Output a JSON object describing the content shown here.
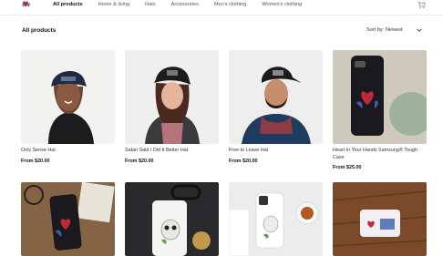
{
  "header": {
    "logo_icon": "heart-butterfly-logo",
    "cart_icon": "shopping-cart-icon",
    "nav": [
      {
        "label": "All products",
        "active": true
      },
      {
        "label": "Home & living",
        "active": false
      },
      {
        "label": "Hats",
        "active": false
      },
      {
        "label": "Accessories",
        "active": false
      },
      {
        "label": "Men's clothing",
        "active": false
      },
      {
        "label": "Women's clothing",
        "active": false
      }
    ]
  },
  "section": {
    "title": "All products",
    "sort_label": "Sort by: Newest",
    "sort_icon": "chevron-down-icon"
  },
  "products": [
    {
      "name": "Only Sense Hat",
      "price": "From $20.00"
    },
    {
      "name": "Satan Said I Did It Better Hat",
      "price": "From $20.00"
    },
    {
      "name": "Free to Leave Hat",
      "price": "From $20.00"
    },
    {
      "name": "Heart In Your Hands Samsung® Tough Case",
      "price": "From $25.00"
    },
    {
      "name": "",
      "price": ""
    },
    {
      "name": "",
      "price": ""
    },
    {
      "name": "",
      "price": ""
    },
    {
      "name": "",
      "price": ""
    }
  ],
  "colors": {
    "accent_heart": "#c0283a",
    "accent_blue": "#2c4a8a",
    "text": "#222222",
    "divider": "#eaeaea"
  }
}
